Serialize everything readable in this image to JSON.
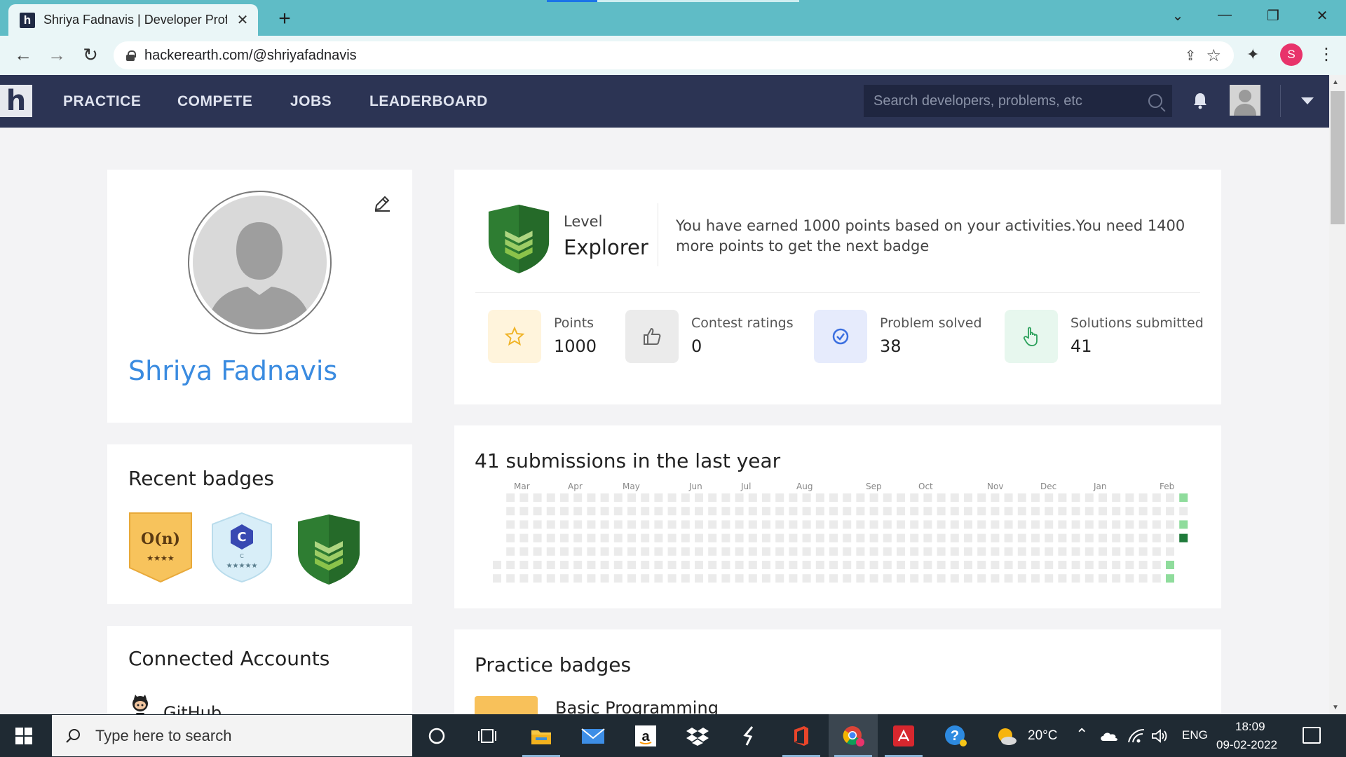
{
  "browser": {
    "tab_title": "Shriya Fadnavis | Developer Profile",
    "tab_close": "✕",
    "new_tab": "+",
    "url": "hackerearth.com/@shriyafadnavis",
    "profile_initial": "S",
    "win_min": "—",
    "win_restore": "❐",
    "win_close": "✕",
    "tab_search": "⌄",
    "back": "←",
    "forward": "→",
    "reload": "↻",
    "share": "⇪",
    "star": "☆",
    "extensions": "✦",
    "menu": "⋮"
  },
  "site": {
    "logo": "h",
    "nav": [
      "PRACTICE",
      "COMPETE",
      "JOBS",
      "LEADERBOARD"
    ],
    "search_placeholder": "Search developers, problems, etc"
  },
  "profile": {
    "name": "Shriya Fadnavis"
  },
  "badges": {
    "heading": "Recent badges",
    "items": [
      {
        "name": "O(n)",
        "stars": "★★★★",
        "color": "#f7c35c"
      },
      {
        "name": "C",
        "stars": "★★★★★",
        "color": "#d8eef8"
      },
      {
        "name": "Explorer",
        "stars": "",
        "color": "#2e7d32"
      }
    ]
  },
  "accounts": {
    "heading": "Connected Accounts",
    "github": "GitHub"
  },
  "level": {
    "label": "Level",
    "value": "Explorer",
    "description": "You have earned 1000 points based on your activities.You need 1400 more points to get the next badge",
    "stats": [
      {
        "label": "Points",
        "value": "1000",
        "icon": "star-icon",
        "bg": "#fff4dc"
      },
      {
        "label": "Contest ratings",
        "value": "0",
        "icon": "thumbs-up-icon",
        "bg": "#ebebeb"
      },
      {
        "label": "Problem solved",
        "value": "38",
        "icon": "check-circle-icon",
        "bg": "#e6ebfc"
      },
      {
        "label": "Solutions submitted",
        "value": "41",
        "icon": "pointer-hand-icon",
        "bg": "#e7f7ee"
      }
    ]
  },
  "activity": {
    "title": "41 submissions in the last year",
    "months": [
      "Mar",
      "Apr",
      "May",
      "Jun",
      "Jul",
      "Aug",
      "Sep",
      "Oct",
      "Nov",
      "Dec",
      "Jan",
      "Feb"
    ]
  },
  "practice": {
    "title": "Practice badges",
    "first_item": "Basic Programming"
  },
  "taskbar": {
    "search_placeholder": "Type here to search",
    "temperature": "20°C",
    "language": "ENG",
    "time": "18:09",
    "date": "09-02-2022"
  }
}
